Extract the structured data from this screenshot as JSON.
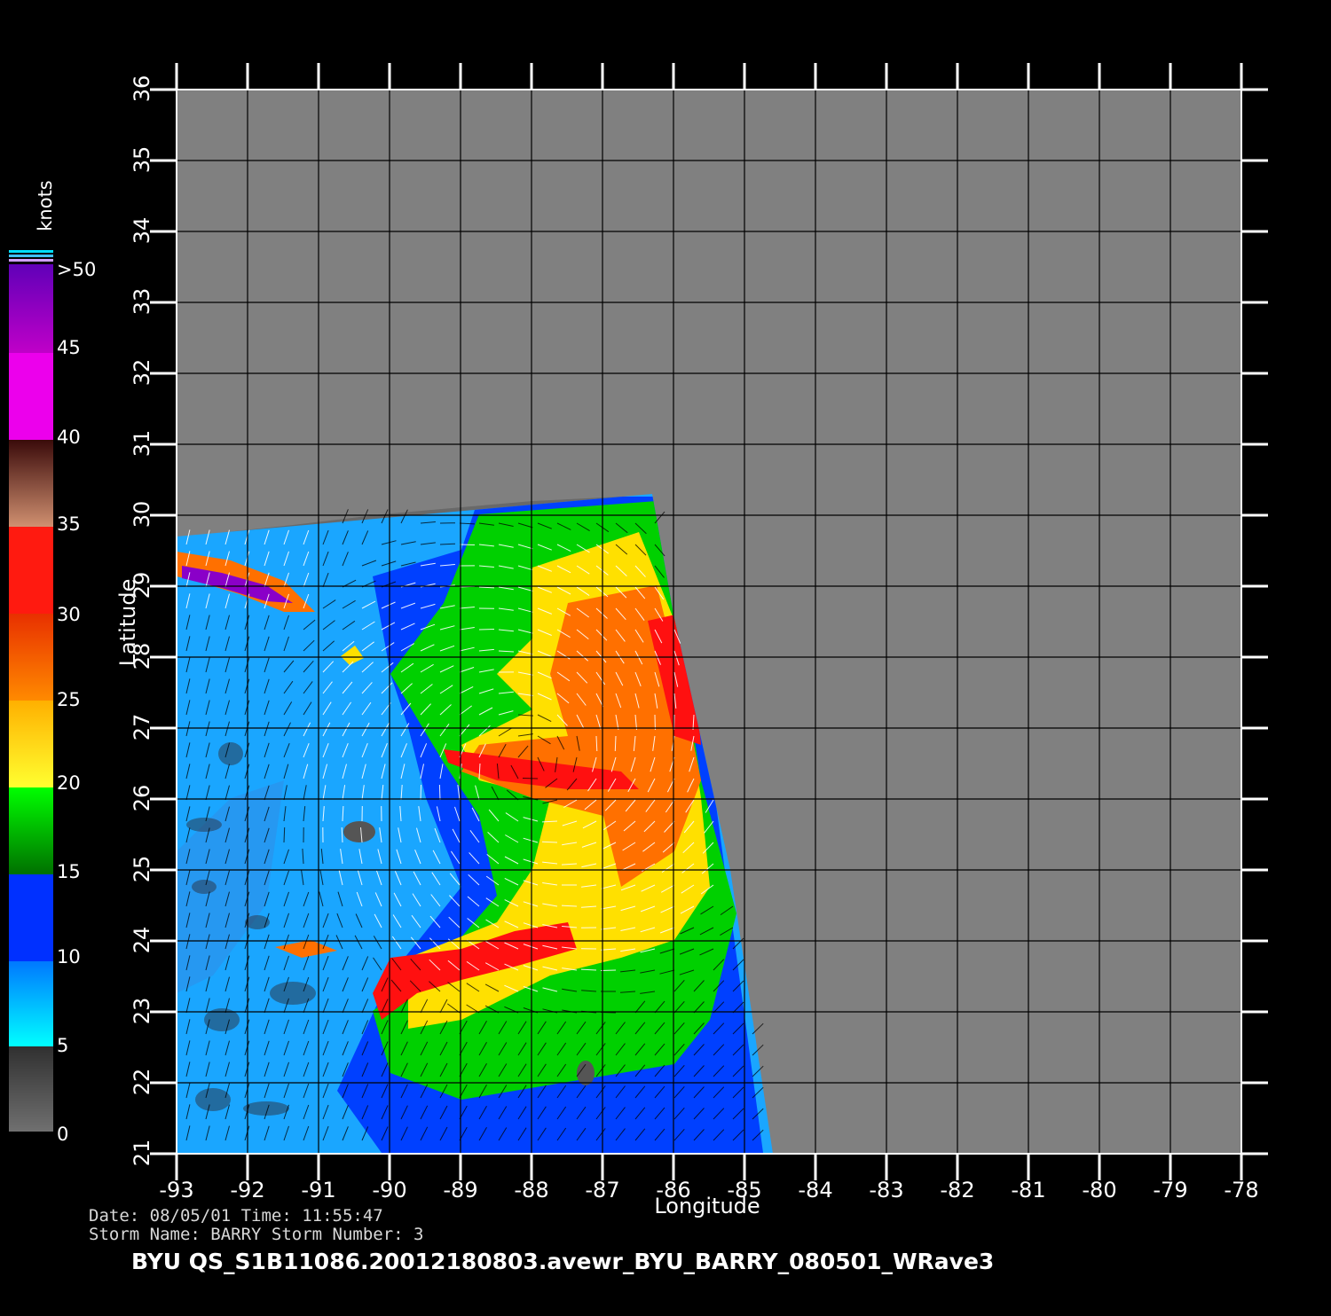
{
  "map": {
    "xlabel": "Longitude",
    "ylabel": "Latitude",
    "lon_range": [
      -93,
      -78
    ],
    "lat_range": [
      21,
      36
    ],
    "lon_ticks": [
      "-93",
      "-92",
      "-91",
      "-90",
      "-89",
      "-88",
      "-87",
      "-86",
      "-85",
      "-84",
      "-83",
      "-82",
      "-81",
      "-80",
      "-79",
      "-78"
    ],
    "lat_ticks": [
      "21",
      "22",
      "23",
      "24",
      "25",
      "26",
      "27",
      "28",
      "29",
      "30",
      "31",
      "32",
      "33",
      "34",
      "35",
      "36"
    ],
    "grid": true,
    "background_color": "#808080",
    "land_colors": [
      "#696969",
      "#555555"
    ],
    "swath_edge": [
      [
        -93,
        29.7
      ],
      [
        -86.3,
        30.3
      ],
      [
        -86.0,
        28.6
      ],
      [
        -85.6,
        26.8
      ],
      [
        -85.2,
        25.0
      ],
      [
        -84.9,
        23.0
      ],
      [
        -84.6,
        21.0
      ],
      [
        -93,
        21.0
      ]
    ]
  },
  "legend": {
    "unit": "knots",
    "labels": [
      ">50",
      "45",
      "40",
      "35",
      "30",
      "25",
      "20",
      "15",
      "10",
      "5",
      "0"
    ],
    "bands": [
      {
        "from": 45,
        "to": 50,
        "color": "#8a00c8"
      },
      {
        "from": 40,
        "to": 45,
        "color": "#e400e8"
      },
      {
        "from": 35,
        "to": 40,
        "color": "#6b2a1e"
      },
      {
        "from": 32.5,
        "to": 35,
        "color": "#c08060"
      },
      {
        "from": 30,
        "to": 32.5,
        "color": "#ff1010"
      },
      {
        "from": 25,
        "to": 30,
        "color": "#ff7000"
      },
      {
        "from": 20,
        "to": 25,
        "color": "#ffe000"
      },
      {
        "from": 15,
        "to": 20,
        "color": "#00d000"
      },
      {
        "from": 10,
        "to": 15,
        "color": "#0040ff"
      },
      {
        "from": 5,
        "to": 10,
        "color": "#10b0ff"
      },
      {
        "from": 0,
        "to": 5,
        "color": "#606060"
      }
    ]
  },
  "info": {
    "date_line": "Date: 08/05/01   Time: 11:55:47",
    "storm_line": "Storm  Name: BARRY   Storm  Number: 3",
    "filename": "BYU  QS_S1B11086.20012180803.avewr_BYU_BARRY_080501_WRave3"
  }
}
